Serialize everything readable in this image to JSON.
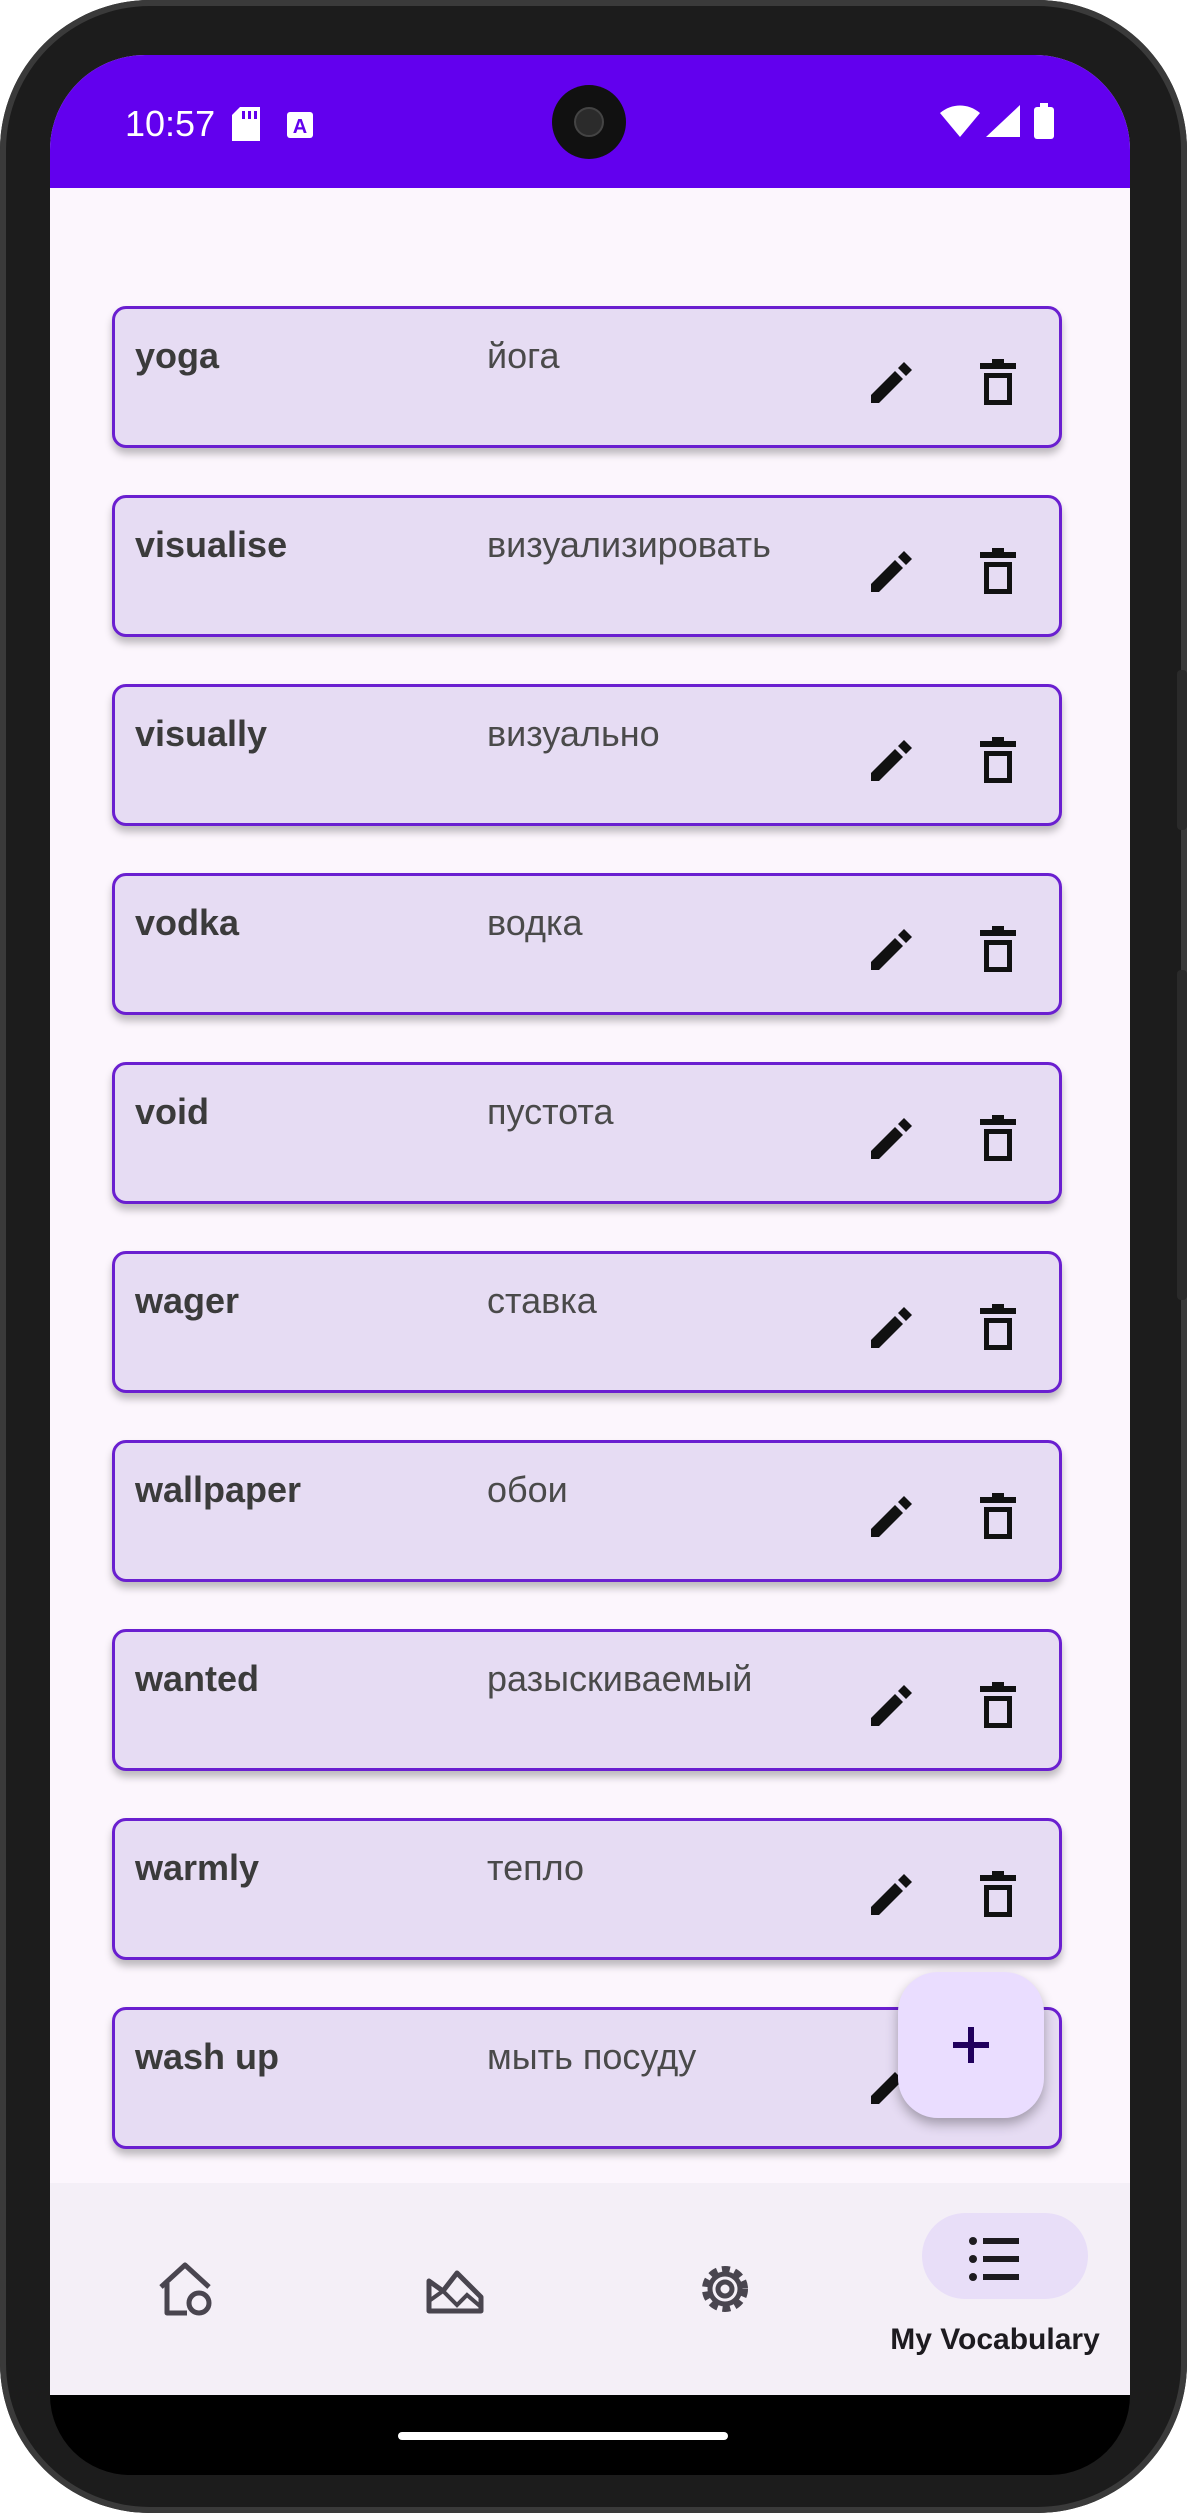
{
  "status_bar": {
    "time": "10:57"
  },
  "vocabulary": [
    {
      "word": "yoga",
      "translation": "йога"
    },
    {
      "word": "visualise",
      "translation": "визуализировать"
    },
    {
      "word": "visually",
      "translation": "визуально"
    },
    {
      "word": "vodka",
      "translation": "водка"
    },
    {
      "word": "void",
      "translation": "пустота"
    },
    {
      "word": "wager",
      "translation": "ставка"
    },
    {
      "word": "wallpaper",
      "translation": "обои"
    },
    {
      "word": "wanted",
      "translation": "разыскиваемый"
    },
    {
      "word": "warmly",
      "translation": "тепло"
    },
    {
      "word": "wash up",
      "translation": "мыть посуду"
    }
  ],
  "fab": {
    "icon": "plus-icon"
  },
  "bottom_nav": {
    "items": [
      {
        "icon": "home-icon",
        "label": ""
      },
      {
        "icon": "landscape-icon",
        "label": ""
      },
      {
        "icon": "settings-icon",
        "label": ""
      },
      {
        "icon": "list-icon",
        "label": "My Vocabulary"
      }
    ],
    "active_index": 3
  },
  "colors": {
    "status_bar": "#6200ee",
    "card_bg": "#e6dcf3",
    "card_border": "#6a1fd0",
    "fab_bg": "#eaddff",
    "nav_bg": "#f4eff7",
    "active_pill": "#e8def8"
  }
}
